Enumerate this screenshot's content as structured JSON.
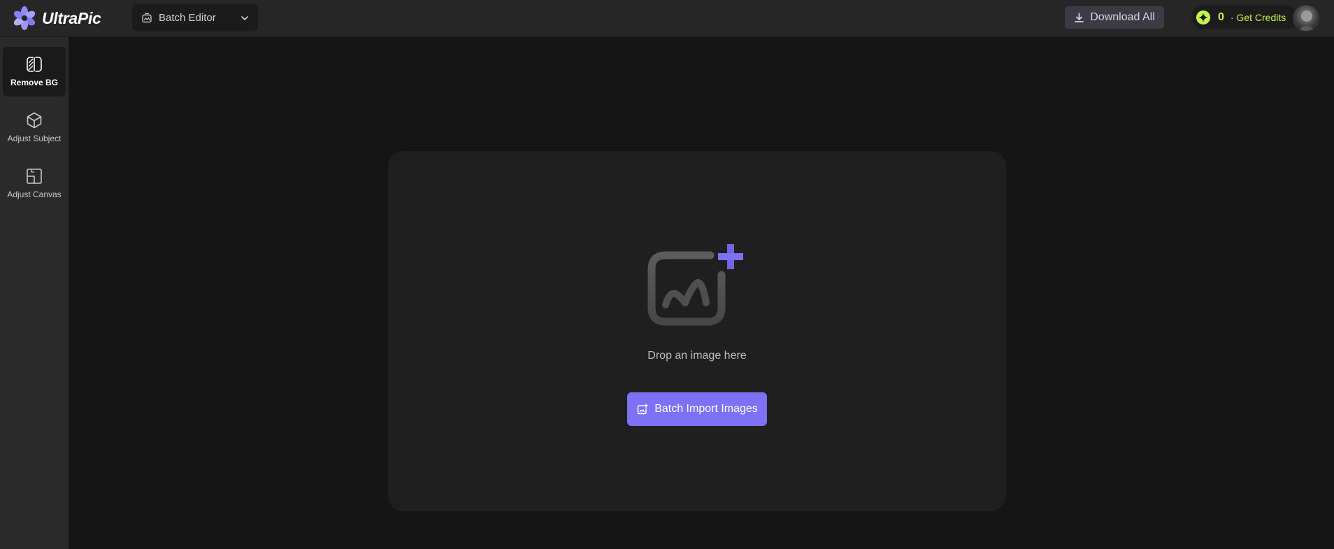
{
  "header": {
    "app_name": "UltraPic",
    "mode": {
      "label": "Batch Editor"
    },
    "download_all_label": "Download All",
    "credits": {
      "count": "0",
      "get_label": "· Get Credits"
    }
  },
  "sidebar": {
    "items": [
      {
        "label": "Remove BG",
        "icon": "remove-bg-icon",
        "active": true
      },
      {
        "label": "Adjust Subject",
        "icon": "cube-icon",
        "active": false
      },
      {
        "label": "Adjust Canvas",
        "icon": "canvas-icon",
        "active": false
      }
    ]
  },
  "main": {
    "drop_text": "Drop an image here",
    "import_label": "Batch Import Images"
  },
  "colors": {
    "accent": "#7d72f5",
    "credits": "#c6f54a",
    "background": "#151515",
    "panel": "#1f1f1f",
    "header": "#262626",
    "sidebar": "#2a2a2a"
  }
}
